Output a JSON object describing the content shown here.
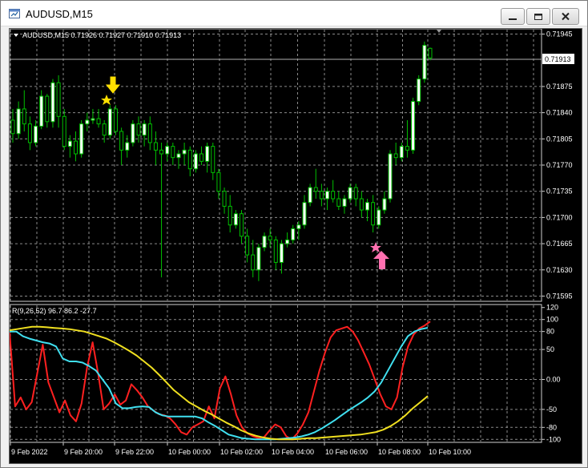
{
  "window": {
    "title": "AUDUSD,M15",
    "controls": [
      "minimize",
      "maximize",
      "close"
    ]
  },
  "colors": {
    "background": "#000000",
    "grid": "#8a8a8a",
    "candle_up_fill": "#ffffff",
    "candle_wick": "#00c000",
    "indicator_red": "#ff2020",
    "indicator_cyan": "#40e0f0",
    "indicator_yellow": "#f0e020",
    "arrow_down": "#ffe000",
    "arrow_up": "#ff70b0",
    "text": "#ffffff"
  },
  "price_panel": {
    "header": "AUDUSD,M15  0.71926 0.71927 0.71910 0.71913",
    "symbol_arrow_icon": "triangle-down-icon",
    "current_price_label": "0.71913",
    "y_axis_ticks": [
      "0.71945",
      "0.71875",
      "0.71840",
      "0.71805",
      "0.71770",
      "0.71735",
      "0.71700",
      "0.71665",
      "0.71630",
      "0.71595"
    ],
    "y_axis_values": [
      0.71945,
      0.71875,
      0.7184,
      0.71805,
      0.7177,
      0.71735,
      0.717,
      0.71665,
      0.7163,
      0.71595
    ],
    "signals": [
      {
        "type": "sell",
        "icon": "arrow-down-icon",
        "star_icon": "star-icon"
      },
      {
        "type": "buy",
        "icon": "arrow-up-icon",
        "star_icon": "star-icon"
      }
    ]
  },
  "indicator_panel": {
    "header": "R(9,26,52) 96.7 86.2 -27.7",
    "y_axis_ticks": [
      "120",
      "100",
      "80",
      "50",
      "0.00",
      "-50",
      "-80",
      "-100"
    ],
    "y_axis_values": [
      120,
      100,
      80,
      50,
      0,
      -50,
      -80,
      -100
    ]
  },
  "x_axis_ticks": [
    "9 Feb 2022",
    "9 Feb 20:00",
    "9 Feb 22:00",
    "10 Feb 00:00",
    "10 Feb 02:00",
    "10 Feb 04:00",
    "10 Feb 06:00",
    "10 Feb 08:00",
    "10 Feb 10:00"
  ],
  "chart_data": [
    {
      "type": "candlestick",
      "title": "AUDUSD,M15",
      "ylim": [
        0.71588,
        0.71952
      ],
      "candles": [
        [
          0.7183,
          0.71845,
          0.718,
          0.71812
        ],
        [
          0.71812,
          0.71855,
          0.71805,
          0.71845
        ],
        [
          0.71845,
          0.7187,
          0.71815,
          0.71825
        ],
        [
          0.71825,
          0.71835,
          0.7179,
          0.718
        ],
        [
          0.718,
          0.7183,
          0.71795,
          0.71822
        ],
        [
          0.71822,
          0.7187,
          0.71818,
          0.71862
        ],
        [
          0.71862,
          0.71865,
          0.7182,
          0.71828
        ],
        [
          0.71828,
          0.71885,
          0.7182,
          0.7188
        ],
        [
          0.7188,
          0.7189,
          0.7182,
          0.71835
        ],
        [
          0.71835,
          0.71845,
          0.7179,
          0.71795
        ],
        [
          0.71795,
          0.7181,
          0.7178,
          0.71802
        ],
        [
          0.71802,
          0.71815,
          0.71775,
          0.71785
        ],
        [
          0.71785,
          0.7183,
          0.7178,
          0.71825
        ],
        [
          0.71825,
          0.7184,
          0.71815,
          0.7183
        ],
        [
          0.7183,
          0.71845,
          0.71825,
          0.71832
        ],
        [
          0.71832,
          0.71845,
          0.7182,
          0.71825
        ],
        [
          0.71825,
          0.7183,
          0.718,
          0.7181
        ],
        [
          0.7181,
          0.7185,
          0.71805,
          0.71845
        ],
        [
          0.71845,
          0.7185,
          0.7181,
          0.71815
        ],
        [
          0.71815,
          0.7182,
          0.7177,
          0.7179
        ],
        [
          0.7179,
          0.7181,
          0.7178,
          0.718
        ],
        [
          0.718,
          0.7183,
          0.71795,
          0.71825
        ],
        [
          0.71825,
          0.71835,
          0.718,
          0.7181
        ],
        [
          0.7181,
          0.7183,
          0.71795,
          0.71825
        ],
        [
          0.71825,
          0.71835,
          0.7179,
          0.718
        ],
        [
          0.718,
          0.71815,
          0.7177,
          0.7179
        ],
        [
          0.7179,
          0.718,
          0.7162,
          0.71785
        ],
        [
          0.71785,
          0.718,
          0.71775,
          0.71795
        ],
        [
          0.71795,
          0.718,
          0.7177,
          0.7178
        ],
        [
          0.7178,
          0.7179,
          0.71765,
          0.71785
        ],
        [
          0.71785,
          0.718,
          0.7177,
          0.7179
        ],
        [
          0.7179,
          0.71795,
          0.71755,
          0.71765
        ],
        [
          0.71765,
          0.7179,
          0.7176,
          0.71785
        ],
        [
          0.71785,
          0.71795,
          0.7177,
          0.71775
        ],
        [
          0.71775,
          0.718,
          0.7176,
          0.71795
        ],
        [
          0.71795,
          0.718,
          0.7175,
          0.7176
        ],
        [
          0.7176,
          0.71765,
          0.71725,
          0.71735
        ],
        [
          0.71735,
          0.7174,
          0.71705,
          0.71715
        ],
        [
          0.71715,
          0.7173,
          0.7168,
          0.7169
        ],
        [
          0.7169,
          0.7171,
          0.71685,
          0.71705
        ],
        [
          0.71705,
          0.7171,
          0.71665,
          0.71675
        ],
        [
          0.71675,
          0.71685,
          0.7164,
          0.7165
        ],
        [
          0.7165,
          0.7167,
          0.7162,
          0.7163
        ],
        [
          0.7163,
          0.71665,
          0.71615,
          0.7166
        ],
        [
          0.7166,
          0.7168,
          0.71655,
          0.71675
        ],
        [
          0.71675,
          0.71685,
          0.7166,
          0.7167
        ],
        [
          0.7167,
          0.71675,
          0.7163,
          0.7164
        ],
        [
          0.7164,
          0.7167,
          0.71625,
          0.71665
        ],
        [
          0.71665,
          0.7168,
          0.7166,
          0.7167
        ],
        [
          0.7167,
          0.7169,
          0.71665,
          0.71685
        ],
        [
          0.71685,
          0.71695,
          0.7167,
          0.7169
        ],
        [
          0.7169,
          0.7173,
          0.71685,
          0.7172
        ],
        [
          0.7172,
          0.71745,
          0.71715,
          0.7174
        ],
        [
          0.7174,
          0.71765,
          0.71725,
          0.71735
        ],
        [
          0.71735,
          0.71745,
          0.71715,
          0.71725
        ],
        [
          0.71725,
          0.7174,
          0.7171,
          0.71735
        ],
        [
          0.71735,
          0.7175,
          0.7172,
          0.71725
        ],
        [
          0.71725,
          0.71735,
          0.7171,
          0.71715
        ],
        [
          0.71715,
          0.7173,
          0.71705,
          0.71725
        ],
        [
          0.71725,
          0.71745,
          0.7172,
          0.7174
        ],
        [
          0.7174,
          0.71745,
          0.71715,
          0.71725
        ],
        [
          0.71725,
          0.71735,
          0.717,
          0.7171
        ],
        [
          0.7171,
          0.71725,
          0.71695,
          0.7172
        ],
        [
          0.7172,
          0.7173,
          0.7168,
          0.7169
        ],
        [
          0.7169,
          0.71715,
          0.71685,
          0.7171
        ],
        [
          0.7171,
          0.71735,
          0.71705,
          0.71725
        ],
        [
          0.71725,
          0.7179,
          0.7172,
          0.71785
        ],
        [
          0.71785,
          0.718,
          0.7177,
          0.7178
        ],
        [
          0.7178,
          0.718,
          0.71775,
          0.71795
        ],
        [
          0.71795,
          0.7183,
          0.7178,
          0.7179
        ],
        [
          0.7179,
          0.7186,
          0.71785,
          0.71855
        ],
        [
          0.71855,
          0.7189,
          0.7185,
          0.71885
        ],
        [
          0.71885,
          0.71935,
          0.7188,
          0.7193
        ],
        [
          0.71926,
          0.71927,
          0.7191,
          0.71913
        ]
      ]
    },
    {
      "type": "line",
      "title": "R(9,26,52) 96.7 86.2 -27.7",
      "ylim": [
        -105,
        125
      ],
      "series": [
        {
          "color": "#ff2020",
          "values": [
            78,
            -45,
            -30,
            -50,
            -38,
            10,
            58,
            -5,
            -30,
            -55,
            -35,
            -60,
            -70,
            -40,
            20,
            62,
            10,
            -50,
            -40,
            -25,
            -42,
            -35,
            -8,
            -18,
            -30,
            -45,
            -52,
            -58,
            -60,
            -65,
            -75,
            -88,
            -92,
            -80,
            -75,
            -70,
            -45,
            -65,
            -15,
            5,
            -25,
            -60,
            -80,
            -90,
            -95,
            -98,
            -96,
            -85,
            -75,
            -80,
            -95,
            -100,
            -90,
            -75,
            -55,
            -20,
            15,
            45,
            70,
            82,
            85,
            88,
            80,
            65,
            45,
            25,
            0,
            -25,
            -45,
            -50,
            -30,
            20,
            55,
            75,
            85,
            90,
            96.7
          ]
        },
        {
          "color": "#40e0f0",
          "values": [
            80,
            80,
            72,
            68,
            65,
            62,
            60,
            55,
            35,
            30,
            30,
            28,
            22,
            15,
            0,
            -15,
            -40,
            -48,
            -48,
            -46,
            -45,
            -46,
            -55,
            -60,
            -62,
            -62,
            -62,
            -62,
            -62,
            -65,
            -72,
            -78,
            -85,
            -92,
            -95,
            -98,
            -99,
            -100,
            -100,
            -100,
            -100,
            -99,
            -98,
            -97,
            -95,
            -92,
            -88,
            -82,
            -75,
            -68,
            -60,
            -52,
            -45,
            -38,
            -30,
            -20,
            -5,
            15,
            35,
            55,
            72,
            80,
            84,
            86.2
          ]
        },
        {
          "color": "#f0e020",
          "values": [
            82,
            84,
            86,
            88,
            88,
            87,
            86,
            85,
            84,
            82,
            80,
            76,
            72,
            68,
            62,
            55,
            48,
            40,
            30,
            20,
            8,
            -5,
            -18,
            -28,
            -38,
            -45,
            -52,
            -58,
            -65,
            -72,
            -78,
            -85,
            -90,
            -94,
            -97,
            -99,
            -100,
            -100,
            -100,
            -99,
            -98,
            -98,
            -97,
            -96,
            -95,
            -94,
            -93,
            -92,
            -90,
            -88,
            -84,
            -78,
            -70,
            -60,
            -48,
            -38,
            -27.7
          ]
        }
      ]
    }
  ]
}
